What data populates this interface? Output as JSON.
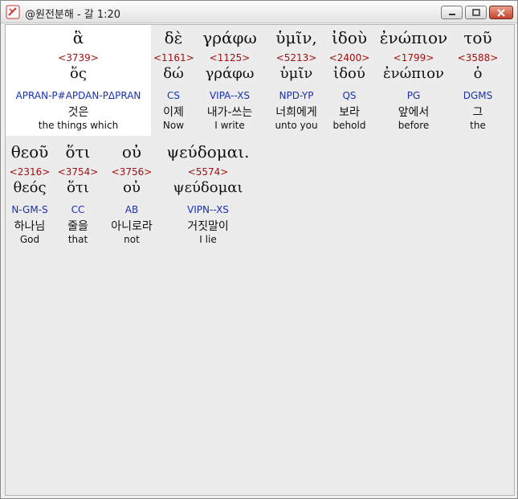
{
  "window": {
    "title": "@원전분해 - 갈 1:20"
  },
  "lines": [
    [
      {
        "greek": "ἃ",
        "strong": "<3739>",
        "lemma": "ὅς",
        "parse": "APRAN-P#APDAN-PΔPRAN",
        "korean": "것은",
        "english": "the things which"
      },
      {
        "greek": "δὲ",
        "strong": "<1161>",
        "lemma": "δώ",
        "parse": "CS",
        "korean": "이제",
        "english": "Now"
      },
      {
        "greek": "γράφω",
        "strong": "<1125>",
        "lemma": "γράφω",
        "parse": "VIPA--XS",
        "korean": "내가-쓰는",
        "english": "I write"
      },
      {
        "greek": "ὑμῖν,",
        "strong": "<5213>",
        "lemma": "ὑμῖν",
        "parse": "NPD-YP",
        "korean": "너희에게",
        "english": "unto you"
      },
      {
        "greek": "ἰδοὺ",
        "strong": "<2400>",
        "lemma": "ἰδού",
        "parse": "QS",
        "korean": "보라",
        "english": "behold"
      },
      {
        "greek": "ἐνώπιον",
        "strong": "<1799>",
        "lemma": "ἐνώπιον",
        "parse": "PG",
        "korean": "앞에서",
        "english": "before"
      },
      {
        "greek": "τοῦ",
        "strong": "<3588>",
        "lemma": "ὁ",
        "parse": "DGMS",
        "korean": "그",
        "english": "the"
      }
    ],
    [
      {
        "greek": "θεοῦ",
        "strong": "<2316>",
        "lemma": "θεός",
        "parse": "N-GM-S",
        "korean": "하나님",
        "english": "God"
      },
      {
        "greek": "ὅτι",
        "strong": "<3754>",
        "lemma": "ὅτι",
        "parse": "CC",
        "korean": "줄을",
        "english": "that"
      },
      {
        "greek": "οὐ",
        "strong": "<3756>",
        "lemma": "οὐ",
        "parse": "AB",
        "korean": "아니로라",
        "english": "not"
      },
      {
        "greek": "ψεύδομαι.",
        "strong": "<5574>",
        "lemma": "ψεύδομαι",
        "parse": "VIPN--XS",
        "korean": "거짓말이",
        "english": "I lie"
      }
    ]
  ]
}
